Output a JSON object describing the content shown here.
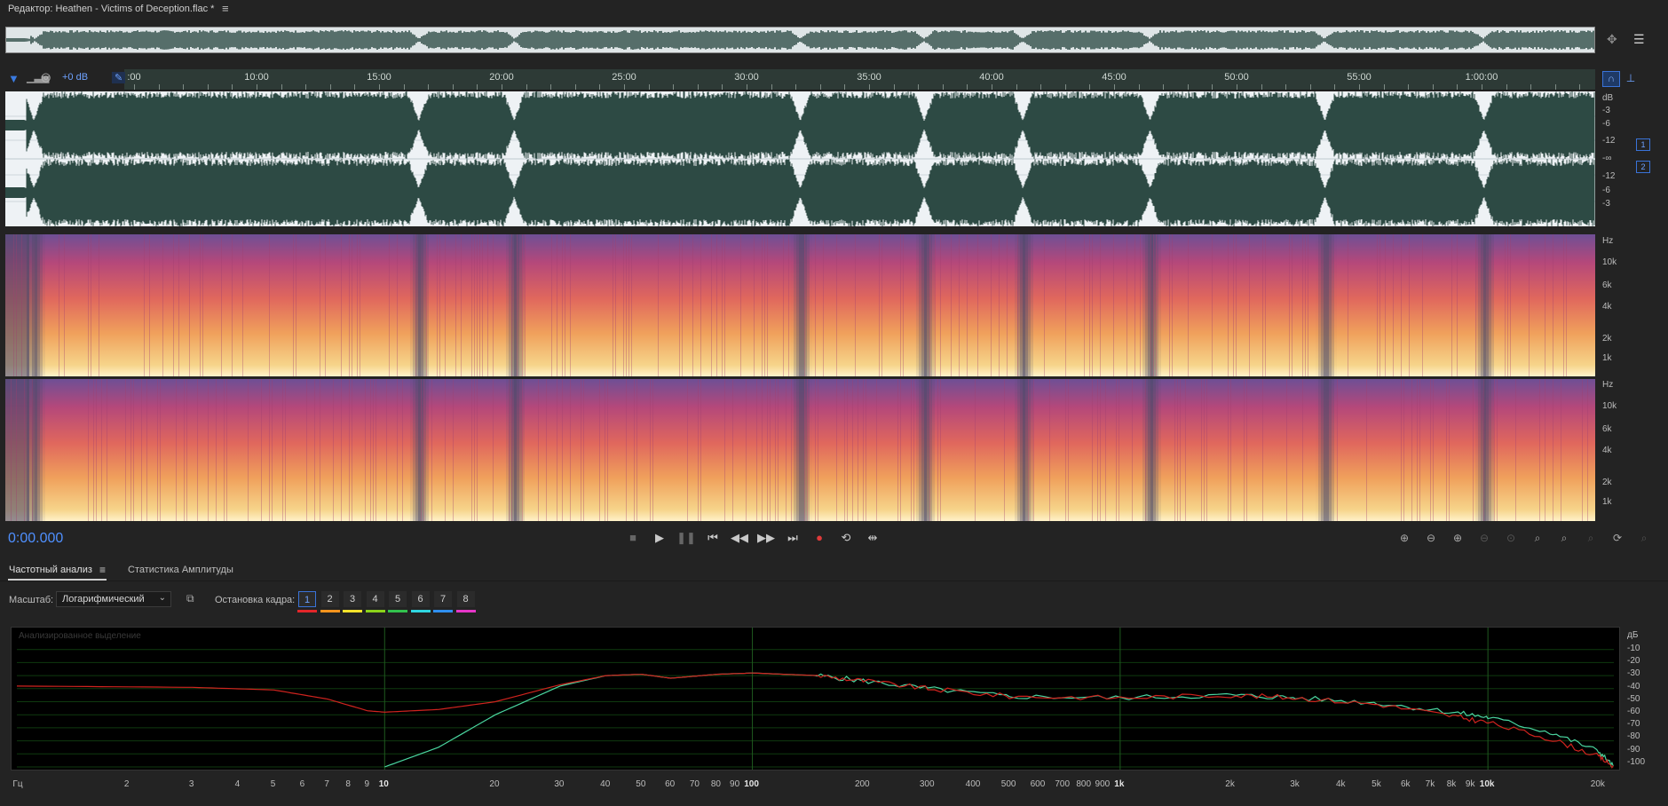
{
  "title": {
    "text": "Редактор: Heathen - Victims of Deception.flac *",
    "menu_icon": "menu-icon"
  },
  "ruler": {
    "ticks": [
      ":00",
      "10:00",
      "15:00",
      "20:00",
      "25:00",
      "30:00",
      "35:00",
      "40:00",
      "45:00",
      "50:00",
      "55:00",
      "1:00:00"
    ]
  },
  "toolbar": {
    "gain": "+0 dB"
  },
  "waveform": {
    "db_labels": [
      "dB",
      "-3",
      "-6",
      "-12",
      "-∞",
      "-12",
      "-6",
      "-3"
    ],
    "channels": [
      "1",
      "2"
    ],
    "gaps": [
      0.018,
      0.26,
      0.32,
      0.5,
      0.578,
      0.64,
      0.72,
      0.83,
      0.93
    ]
  },
  "spectral": {
    "hz_labels": [
      "Hz",
      "10k",
      "6k",
      "4k",
      "2k",
      "1k"
    ]
  },
  "transport": {
    "timecode": "0:00.000",
    "buttons": [
      "stop",
      "play",
      "pause",
      "go-to-start",
      "rewind",
      "fast-forward",
      "go-to-end",
      "record",
      "loop",
      "skip"
    ]
  },
  "panel": {
    "tab_frequency": "Частотный анализ",
    "tab_amplitude": "Статистика Амплитуды",
    "scale_label": "Масштаб:",
    "scale_value": "Логарифмический",
    "freeze_label": "Остановка кадра:",
    "freeze_slots": [
      "1",
      "2",
      "3",
      "4",
      "5",
      "6",
      "7",
      "8"
    ],
    "freeze_colors": [
      "#e3262a",
      "#f7941d",
      "#f5e22b",
      "#8cd21a",
      "#32c24d",
      "#2fd6e0",
      "#2f8ff0",
      "#e636c8"
    ],
    "plot_caption": "Анализированное выделение",
    "db_labels": [
      "дБ",
      "-10",
      "-20",
      "-30",
      "-40",
      "-50",
      "-60",
      "-70",
      "-80",
      "-90",
      "-100"
    ],
    "freq_labels": [
      "Гц",
      "2",
      "3",
      "4",
      "5",
      "6",
      "7",
      "8",
      "9",
      "10",
      "20",
      "30",
      "40",
      "50",
      "60",
      "70",
      "80",
      "90",
      "100",
      "200",
      "300",
      "400",
      "500",
      "600",
      "700",
      "800",
      "900",
      "1k",
      "2k",
      "3k",
      "4k",
      "5k",
      "6k",
      "7k",
      "8k",
      "9k",
      "10k",
      "20k"
    ]
  },
  "colors": {
    "accent": "#4f90ff",
    "wave": "#2d4a44",
    "curve_left": "#d0231e",
    "curve_right": "#4ad6a0"
  }
}
